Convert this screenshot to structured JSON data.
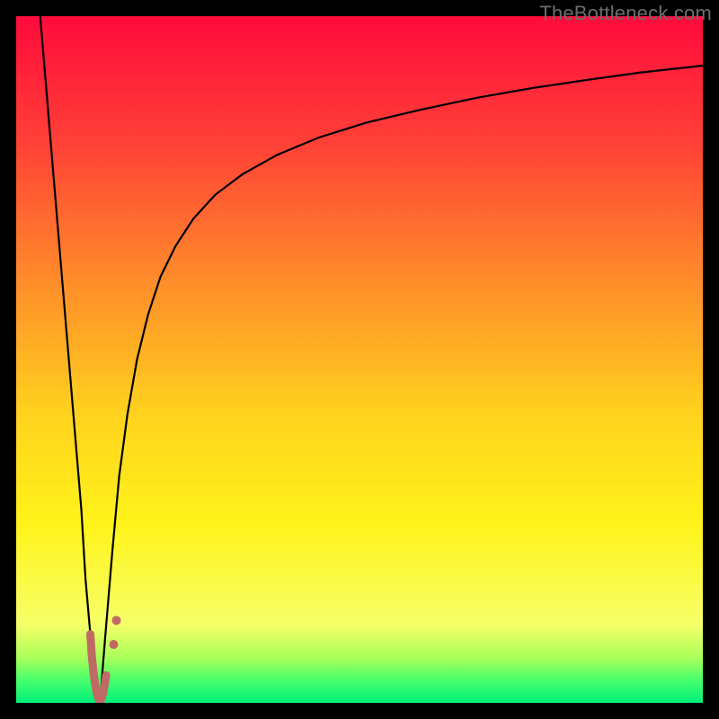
{
  "watermark": "TheBottleneck.com",
  "chart_data": {
    "type": "line",
    "title": "",
    "xlabel": "",
    "ylabel": "",
    "xlim": [
      0,
      100
    ],
    "ylim": [
      0,
      100
    ],
    "grid": false,
    "legend": false,
    "gradient_stops": [
      {
        "offset": 0.0,
        "color": "#ff0b3c"
      },
      {
        "offset": 0.18,
        "color": "#ff3f37"
      },
      {
        "offset": 0.38,
        "color": "#ff8a2a"
      },
      {
        "offset": 0.58,
        "color": "#ffd21e"
      },
      {
        "offset": 0.74,
        "color": "#fff31a"
      },
      {
        "offset": 0.885,
        "color": "#f7ff68"
      },
      {
        "offset": 0.935,
        "color": "#a8ff5a"
      },
      {
        "offset": 0.965,
        "color": "#4cff6b"
      },
      {
        "offset": 1.0,
        "color": "#00f07a"
      }
    ],
    "series": [
      {
        "name": "bottleneck-left",
        "color": "#000000",
        "stroke_width": 2.2,
        "x": [
          3.5,
          4.5,
          5.5,
          6.5,
          7.5,
          8.5,
          9.5,
          10.1,
          10.8,
          11.3,
          11.7,
          12.2
        ],
        "values": [
          100,
          88,
          76,
          64,
          52,
          40,
          28,
          18,
          10,
          5,
          2,
          0
        ]
      },
      {
        "name": "bottleneck-right",
        "color": "#000000",
        "stroke_width": 2.2,
        "x": [
          12.2,
          13.0,
          14.0,
          15.0,
          16.2,
          17.6,
          19.2,
          21.0,
          23.2,
          25.8,
          29.0,
          33.0,
          38.0,
          44.0,
          51.0,
          59.0,
          67.0,
          75.0,
          83.0,
          91.0,
          100.0
        ],
        "values": [
          0,
          10,
          22,
          33,
          42,
          50,
          56.5,
          62,
          66.5,
          70.5,
          74,
          77,
          79.8,
          82.3,
          84.5,
          86.4,
          88.1,
          89.5,
          90.7,
          91.8,
          92.8
        ]
      },
      {
        "name": "marker-trail",
        "type": "scatter",
        "color": "#c06a64",
        "stroke_width": 9,
        "linecap": "round",
        "points": [
          {
            "x": 10.8,
            "y": 10
          },
          {
            "x": 11.0,
            "y": 7
          },
          {
            "x": 11.3,
            "y": 4
          },
          {
            "x": 11.7,
            "y": 1.5
          },
          {
            "x": 12.2,
            "y": 0
          },
          {
            "x": 12.7,
            "y": 1.5
          },
          {
            "x": 13.1,
            "y": 4
          }
        ]
      },
      {
        "name": "marker-dots",
        "type": "scatter",
        "color": "#c06a64",
        "radius": 5,
        "points": [
          {
            "x": 14.2,
            "y": 8.5
          },
          {
            "x": 14.6,
            "y": 12
          }
        ]
      }
    ]
  }
}
